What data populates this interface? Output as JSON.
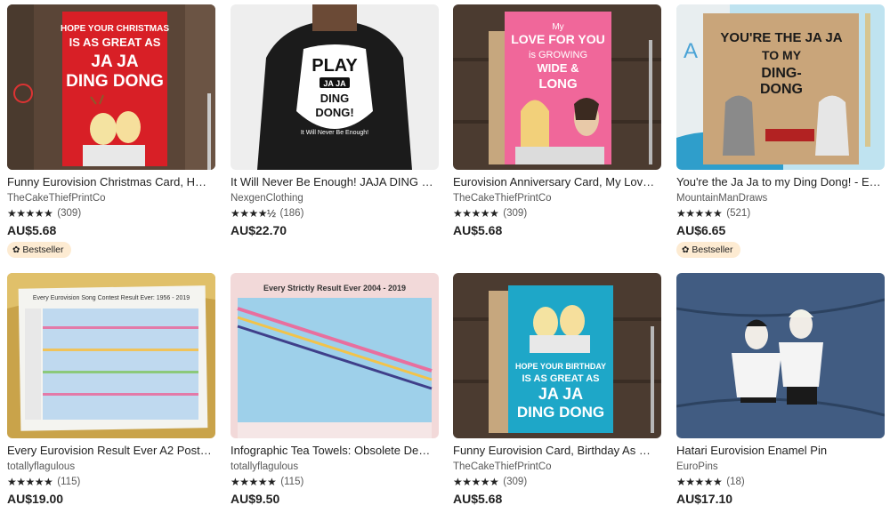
{
  "listings": [
    {
      "title": "Funny Eurovision Christmas Card, H…",
      "shop": "TheCakeThiefPrintCo",
      "stars": "★★★★★",
      "reviews": "(309)",
      "price": "AU$5.68",
      "badge": "Bestseller",
      "image_text": [
        "HOPE YOUR CHRISTMAS",
        "IS AS GREAT AS",
        "JA JA",
        "DING DONG"
      ]
    },
    {
      "title": "It Will Never Be Enough! JAJA DING …",
      "shop": "NexgenClothing",
      "stars": "★★★★½",
      "reviews": "(186)",
      "price": "AU$22.70",
      "image_text": [
        "PLAY",
        "JA JA",
        "DING",
        "DONG!",
        "It Will Never Be Enough!"
      ]
    },
    {
      "title": "Eurovision Anniversary Card, My Lov…",
      "shop": "TheCakeThiefPrintCo",
      "stars": "★★★★★",
      "reviews": "(309)",
      "price": "AU$5.68",
      "image_text": [
        "My",
        "LOVE FOR YOU",
        "is GROWING",
        "WIDE &",
        "LONG"
      ]
    },
    {
      "title": "You're the Ja Ja to my Ding Dong! - E…",
      "shop": "MountainManDraws",
      "stars": "★★★★★",
      "reviews": "(521)",
      "price": "AU$6.65",
      "badge": "Bestseller",
      "image_text": [
        "YOU'RE THE JA JA",
        "TO MY",
        "DING-",
        "DONG"
      ]
    },
    {
      "title": "Every Eurovision Result Ever A2 Post…",
      "shop": "totallyflagulous",
      "stars": "★★★★★",
      "reviews": "(115)",
      "price": "AU$19.00",
      "image_text": [
        "Every Eurovision Song Contest Result Ever: 1956 - 2019"
      ]
    },
    {
      "title": "Infographic Tea Towels: Obsolete De…",
      "shop": "totallyflagulous",
      "stars": "★★★★★",
      "reviews": "(115)",
      "price": "AU$9.50",
      "image_text": [
        "Every Strictly Result Ever 2004 - 2019"
      ]
    },
    {
      "title": "Funny Eurovision Card, Birthday As …",
      "shop": "TheCakeThiefPrintCo",
      "stars": "★★★★★",
      "reviews": "(309)",
      "price": "AU$5.68",
      "image_text": [
        "HOPE YOUR BIRTHDAY",
        "IS AS GREAT AS",
        "JA JA",
        "DING DONG"
      ]
    },
    {
      "title": "Hatari Eurovision Enamel Pin",
      "shop": "EuroPins",
      "stars": "★★★★★",
      "reviews": "(18)",
      "price": "AU$17.10",
      "image_text": []
    }
  ],
  "colors": {
    "badge_bg": "#fdebd2",
    "card_red": "#d81f26",
    "card_pink": "#f0679a",
    "card_teal": "#1ea7c8",
    "denim": "#3b5578"
  }
}
